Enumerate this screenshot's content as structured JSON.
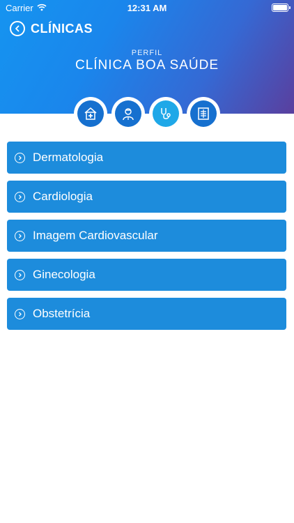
{
  "status_bar": {
    "carrier": "Carrier",
    "time": "12:31 AM"
  },
  "nav": {
    "back_label": "CLÍNICAS"
  },
  "profile": {
    "subtitle": "PERFIL",
    "clinic_name": "CLÍNICA BOA SAÚDE"
  },
  "icon_tabs": [
    {
      "icon": "hospital-icon",
      "active": false
    },
    {
      "icon": "doctor-icon",
      "active": false
    },
    {
      "icon": "stethoscope-icon",
      "active": true
    },
    {
      "icon": "xray-icon",
      "active": false
    }
  ],
  "specialties": [
    {
      "label": "Dermatologia"
    },
    {
      "label": "Cardiologia"
    },
    {
      "label": "Imagem Cardiovascular"
    },
    {
      "label": "Ginecologia"
    },
    {
      "label": "Obstetrícia"
    }
  ],
  "colors": {
    "header_start": "#1594f0",
    "header_end": "#5a3f9e",
    "list_item": "#1d8cdc",
    "icon_bg": "#1670cf",
    "icon_active": "#1fa8e8"
  }
}
